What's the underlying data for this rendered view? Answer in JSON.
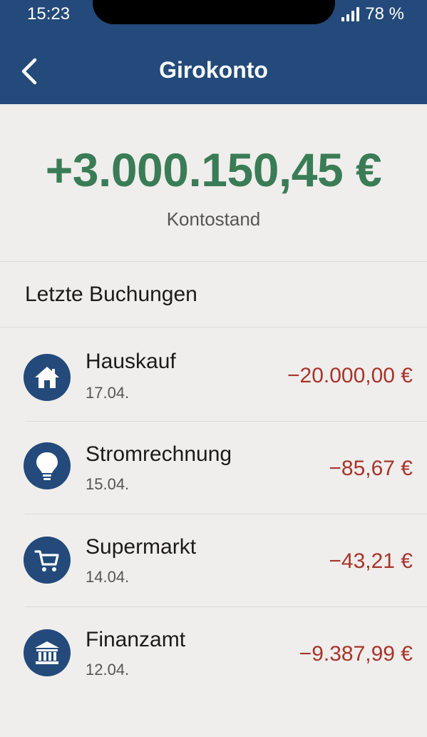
{
  "status_bar": {
    "time": "15:23",
    "battery": "78 %"
  },
  "nav": {
    "title": "Girokonto",
    "back_icon": "chevron-left-icon"
  },
  "account": {
    "balance": "+3.000.150,45 €",
    "balance_label": "Kontostand"
  },
  "section": {
    "title": "Letzte Buchungen"
  },
  "transactions": [
    {
      "name": "Hauskauf",
      "date": "17.04.",
      "amount": "−20.000,00 €",
      "icon": "house-icon"
    },
    {
      "name": "Stromrechnung",
      "date": "15.04.",
      "amount": "−85,67 €",
      "icon": "lightbulb-icon"
    },
    {
      "name": "Supermarkt",
      "date": "14.04.",
      "amount": "−43,21 €",
      "icon": "cart-icon"
    },
    {
      "name": "Finanzamt",
      "date": "12.04.",
      "amount": "−9.387,99 €",
      "icon": "bank-icon"
    }
  ],
  "colors": {
    "header": "#234a7a",
    "positive": "#3a7c56",
    "negative": "#a8342b",
    "background": "#efeeec"
  }
}
